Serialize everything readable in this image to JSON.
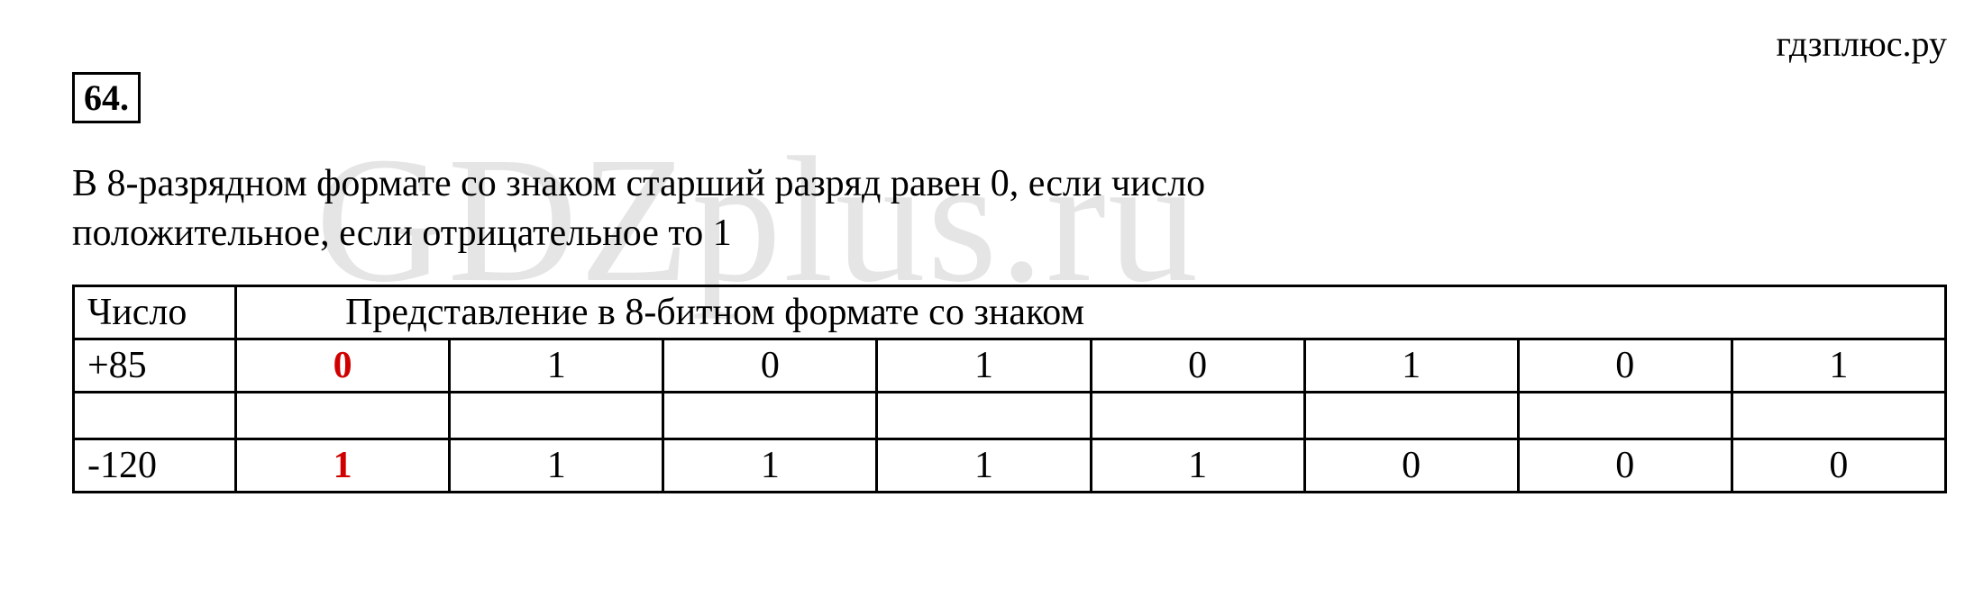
{
  "watermark_top": "гдзплюс.ру",
  "watermark_bg": "GDZplus.ru",
  "task_number": "64",
  "task_dot": ".",
  "explanation": "В 8-разрядном формате со знаком старший разряд равен 0, если число положительное, если отрицательное то 1",
  "table": {
    "header_col1": "Число",
    "header_span": "Представление в 8-битном формате со знаком",
    "rows": [
      {
        "number": "+85",
        "sign_bit": "0",
        "bits": [
          "1",
          "0",
          "1",
          "0",
          "1",
          "0",
          "1"
        ]
      },
      {
        "number": "",
        "sign_bit": "",
        "bits": [
          "",
          "",
          "",
          "",
          "",
          "",
          ""
        ]
      },
      {
        "number": "-120",
        "sign_bit": "1",
        "bits": [
          "1",
          "1",
          "1",
          "1",
          "0",
          "0",
          "0"
        ]
      }
    ]
  }
}
